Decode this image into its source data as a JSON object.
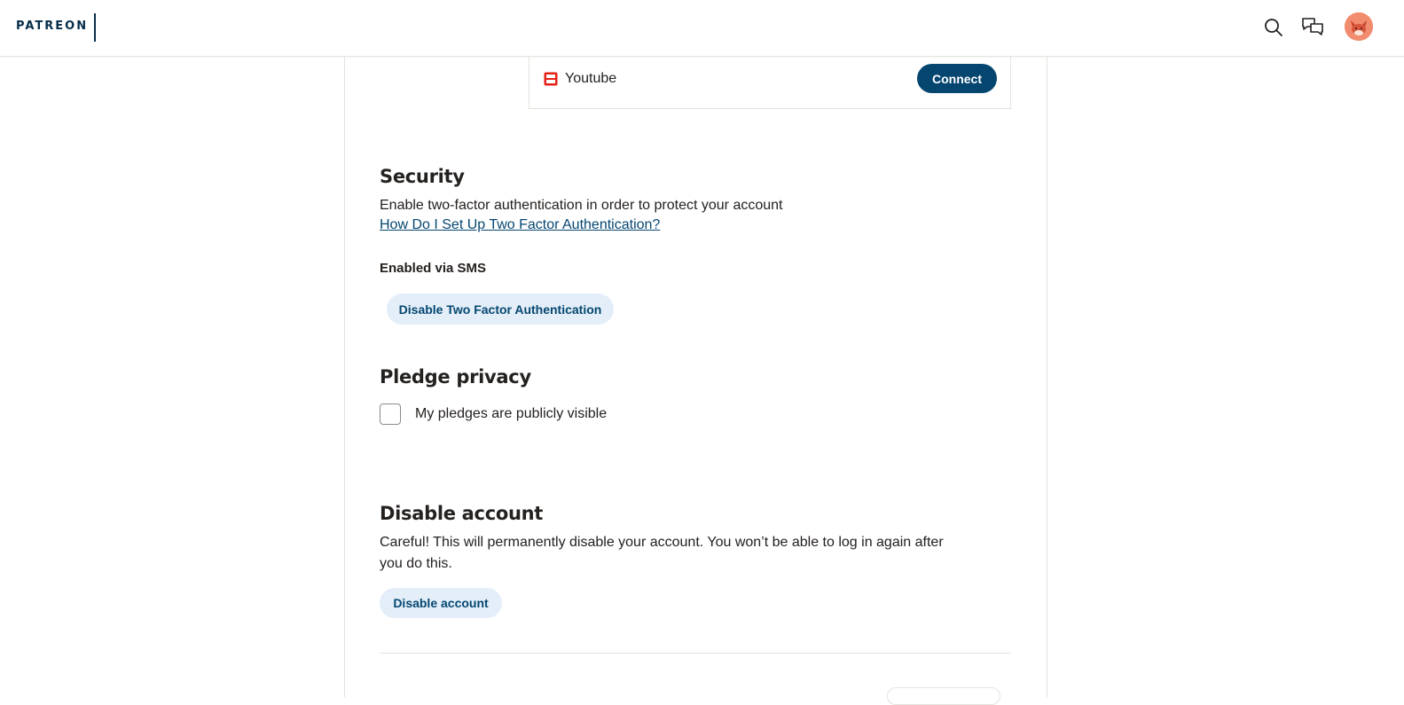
{
  "header": {
    "logo": "PATREON",
    "search_icon": "search-icon",
    "messages_icon": "chat-bubbles-icon",
    "avatar_icon": "user-avatar"
  },
  "connected_apps": {
    "youtube_label": "Youtube",
    "connect_label": "Connect",
    "youtube_color": "#e62117",
    "connect_color": "#054671"
  },
  "security": {
    "title": "Security",
    "description": "Enable two-factor authentication in order to protect your account",
    "help_link": "How Do I Set Up Two Factor Authentication?",
    "status": "Enabled via SMS",
    "disable_2fa_label": "Disable Two Factor Authentication"
  },
  "pledge_privacy": {
    "title": "Pledge privacy",
    "checkbox_label": "My pledges are publicly visible",
    "checked": false
  },
  "disable_account": {
    "title": "Disable account",
    "description": "Careful! This will permanently disable your account. You won’t be able to log in again after you do this.",
    "button_label": "Disable account"
  }
}
